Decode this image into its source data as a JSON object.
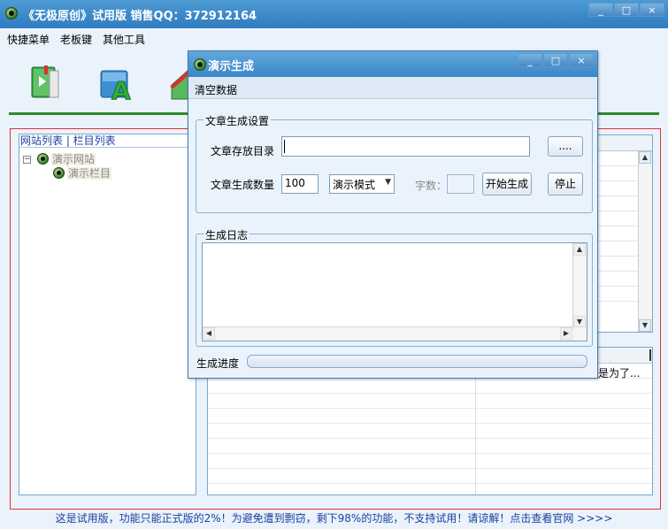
{
  "main_window": {
    "title": "《无极原创》试用版 销售QQ：372912164",
    "controls": {
      "minimize": "_",
      "maximize": "□",
      "close": "×"
    }
  },
  "menu": [
    "快捷菜单",
    "老板键",
    "其他工具"
  ],
  "toolbar_icons": [
    "green-book-icon",
    "blue-a-icon",
    "green-house-icon"
  ],
  "tree": {
    "tabs_label": "网站列表 | 栏目列表",
    "expander": "−",
    "nodes": [
      {
        "label": "演示网站",
        "icon": "site-icon"
      },
      {
        "label": "演示栏目",
        "icon": "column-icon"
      }
    ]
  },
  "bottom_list": {
    "truncated_cell": "是为了..."
  },
  "status_bar": "这是试用版，功能只能正式版的2%！为避免遭到剽窃，剩下98%的功能，不支持试用！请谅解！点击查看官网 >>>>",
  "dialog": {
    "title": "演示生成",
    "controls": {
      "minimize": "_",
      "maximize": "□",
      "close": "×"
    },
    "menu_item": "清空数据",
    "settings_group": {
      "legend": "文章生成设置",
      "dir_label": "文章存放目录",
      "dir_value": "",
      "browse_button": "....",
      "count_label": "文章生成数量",
      "count_value": "100",
      "mode_selected": "演示模式",
      "wordcount_label": "字数：",
      "wordcount_value": "",
      "start_button": "开始生成",
      "stop_button": "停止"
    },
    "log_group": {
      "legend": "生成日志",
      "content": ""
    },
    "progress": {
      "label": "生成进度",
      "percent": 0
    }
  },
  "colors": {
    "titlebar": "#2f7cc0",
    "accent_green": "#2c8a2a",
    "border_red": "#e03030",
    "link_blue": "#1c3fa0"
  }
}
